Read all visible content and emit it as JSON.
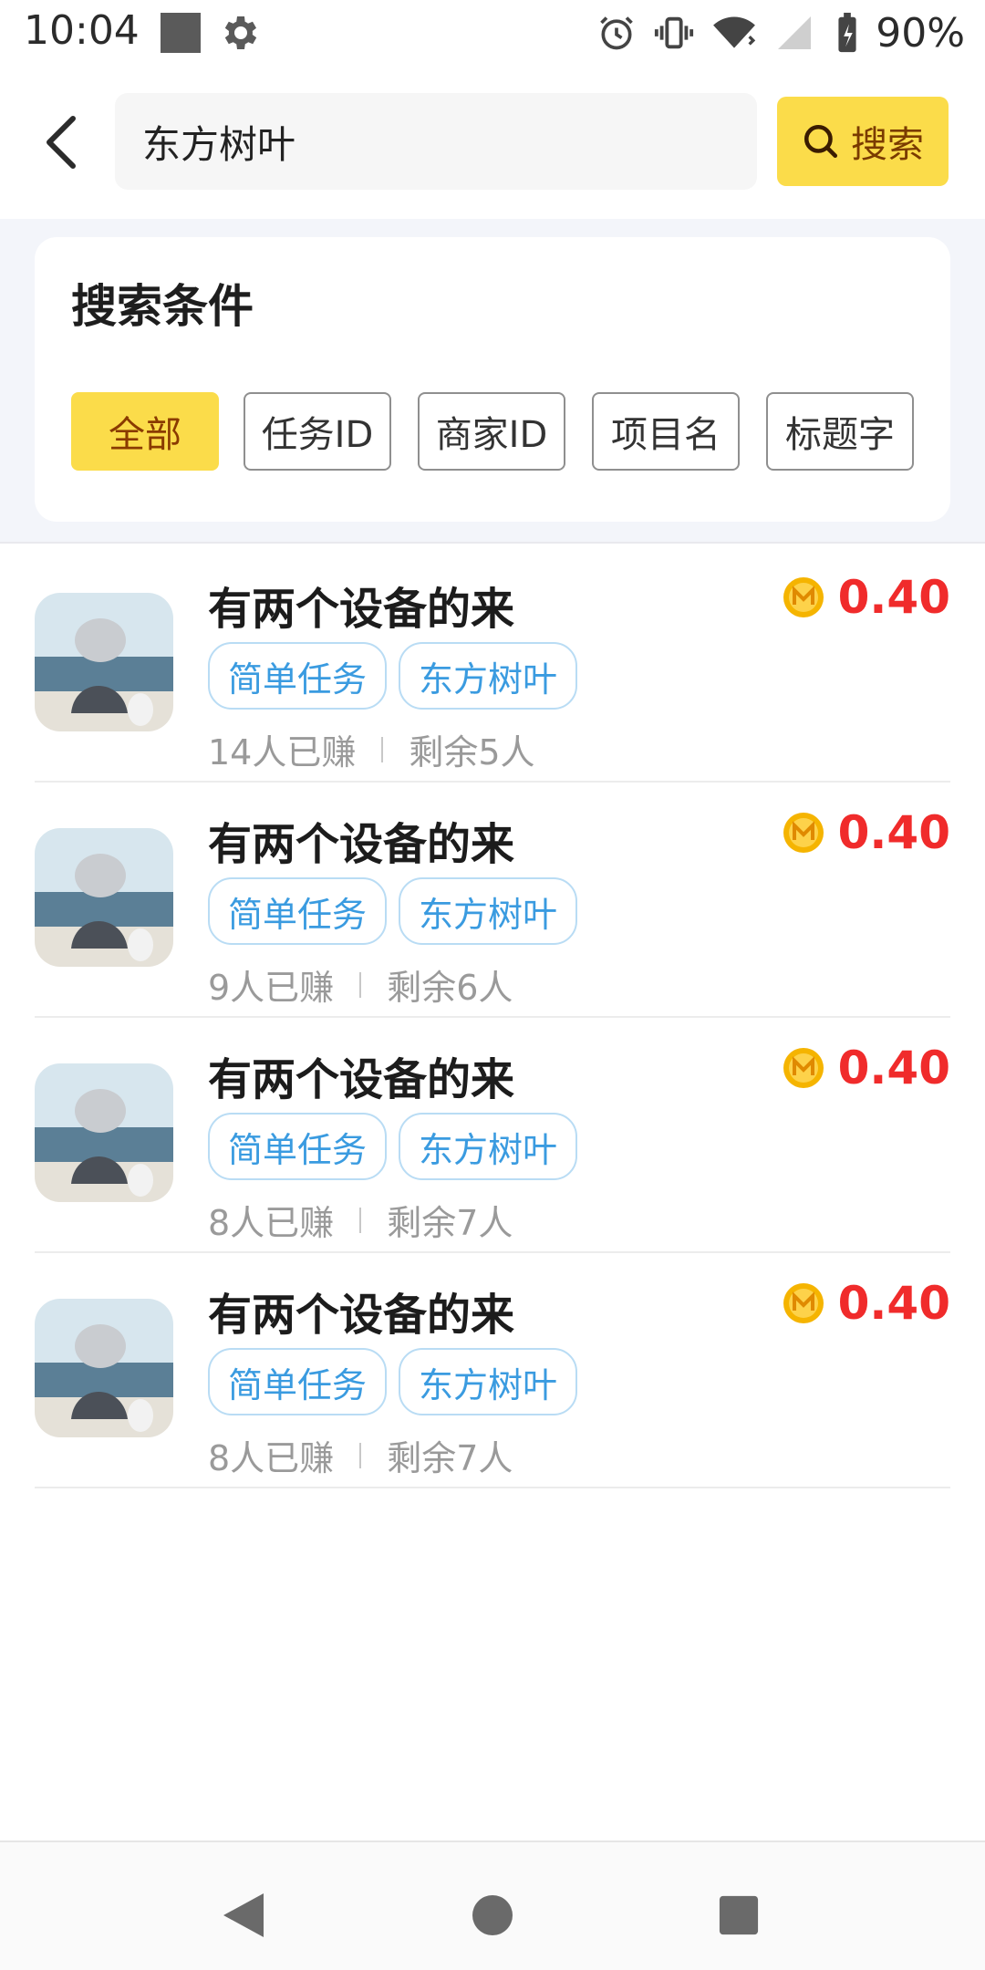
{
  "status_bar": {
    "time": "10:04",
    "battery": "90%"
  },
  "header": {
    "search_value": "东方树叶",
    "search_button_label": "搜索"
  },
  "criteria": {
    "title": "搜索条件",
    "chips": [
      "全部",
      "任务ID",
      "商家ID",
      "项目名",
      "标题字"
    ],
    "selected": "全部"
  },
  "tasks": [
    {
      "title": "有两个设备的来",
      "tags": [
        "简单任务",
        "东方树叶"
      ],
      "earned": "14人已赚",
      "remaining": "剩余5人",
      "reward": "0.40"
    },
    {
      "title": "有两个设备的来",
      "tags": [
        "简单任务",
        "东方树叶"
      ],
      "earned": "9人已赚",
      "remaining": "剩余6人",
      "reward": "0.40"
    },
    {
      "title": "有两个设备的来",
      "tags": [
        "简单任务",
        "东方树叶"
      ],
      "earned": "8人已赚",
      "remaining": "剩余7人",
      "reward": "0.40"
    },
    {
      "title": "有两个设备的来",
      "tags": [
        "简单任务",
        "东方树叶"
      ],
      "earned": "8人已赚",
      "remaining": "剩余7人",
      "reward": "0.40"
    }
  ],
  "colors": {
    "accent_yellow": "#fbdc4a",
    "reward_red": "#f02b2b",
    "tag_blue": "#3a9be0",
    "coin_gold": "#f5b400"
  },
  "icons": {
    "status": [
      "image-icon",
      "gear-icon",
      "alarm-icon",
      "vibrate-icon",
      "wifi-icon",
      "signal-icon",
      "battery-icon"
    ],
    "header": [
      "back-arrow-icon",
      "search-icon"
    ],
    "nav": [
      "back-triangle-icon",
      "home-circle-icon",
      "recents-square-icon"
    ]
  }
}
